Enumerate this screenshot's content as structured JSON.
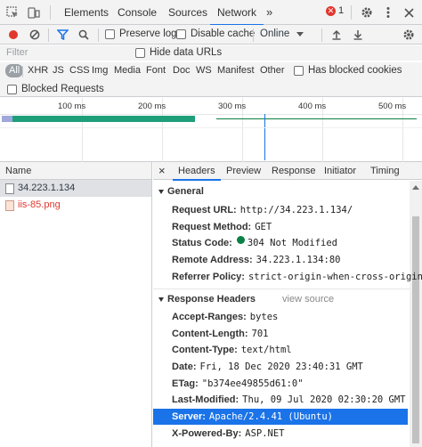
{
  "topbar": {
    "tabs": [
      "Elements",
      "Console",
      "Sources",
      "Network"
    ],
    "active_tab": "Network",
    "more": "»",
    "error_count": "1",
    "error_symbol": "✕"
  },
  "toolbar": {
    "preserve_log": "Preserve log",
    "disable_cache": "Disable cache",
    "throttle": "Online"
  },
  "filter": {
    "placeholder": "Filter",
    "hide_data_urls": "Hide data URLs"
  },
  "types": [
    "All",
    "XHR",
    "JS",
    "CSS",
    "Img",
    "Media",
    "Font",
    "Doc",
    "WS",
    "Manifest",
    "Other"
  ],
  "has_blocked_cookies": "Has blocked cookies",
  "blocked_requests": "Blocked Requests",
  "overview": {
    "ticks": [
      "100 ms",
      "200 ms",
      "300 ms",
      "400 ms",
      "500 ms"
    ],
    "colors": {
      "receive": "#1e9f7a",
      "wait": "#0b8043",
      "blue_marker": "#1a73e8"
    }
  },
  "requests": {
    "header": "Name",
    "rows": [
      {
        "name": "34.223.1.134",
        "type": "doc",
        "selected": true
      },
      {
        "name": "iis-85.png",
        "type": "img",
        "error": true
      }
    ]
  },
  "detail": {
    "close": "×",
    "tabs": [
      "Headers",
      "Preview",
      "Response",
      "Initiator",
      "Timing"
    ],
    "active_tab": "Headers",
    "general": {
      "title": "General",
      "items": [
        {
          "k": "Request URL:",
          "v": "http://34.223.1.134/"
        },
        {
          "k": "Request Method:",
          "v": "GET"
        },
        {
          "k": "Status Code:",
          "v": "304 Not Modified"
        },
        {
          "k": "Remote Address:",
          "v": "34.223.1.134:80"
        },
        {
          "k": "Referrer Policy:",
          "v": "strict-origin-when-cross-origin"
        }
      ]
    },
    "response_headers": {
      "title": "Response Headers",
      "view_source": "view source",
      "items": [
        {
          "k": "Accept-Ranges:",
          "v": "bytes"
        },
        {
          "k": "Content-Length:",
          "v": "701"
        },
        {
          "k": "Content-Type:",
          "v": "text/html"
        },
        {
          "k": "Date:",
          "v": "Fri, 18 Dec 2020 23:40:31 GMT"
        },
        {
          "k": "ETag:",
          "v": "\"b374ee49855d61:0\""
        },
        {
          "k": "Last-Modified:",
          "v": "Thu, 09 Jul 2020 02:30:20 GMT"
        },
        {
          "k": "Server:",
          "v": "Apache/2.4.41 (Ubuntu)",
          "highlighted": true
        },
        {
          "k": "X-Powered-By:",
          "v": "ASP.NET"
        }
      ]
    }
  }
}
